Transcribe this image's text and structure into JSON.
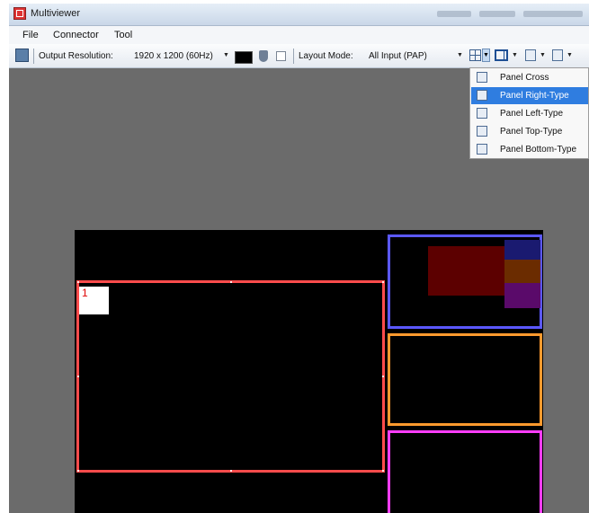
{
  "window": {
    "title": "Multiviewer"
  },
  "menubar": {
    "items": [
      "File",
      "Connector",
      "Tool"
    ]
  },
  "toolbar": {
    "output_resolution_label": "Output Resolution:",
    "output_resolution_value": "1920 x 1200 (60Hz)",
    "background_color": "#000000",
    "layout_mode_label": "Layout Mode:",
    "layout_mode_value": "All Input (PAP)"
  },
  "layout_dropdown": {
    "items": [
      "Panel Cross",
      "Panel Right-Type",
      "Panel Left-Type",
      "Panel Top-Type",
      "Panel Bottom-Type"
    ],
    "selected": "Panel Right-Type"
  },
  "preview": {
    "main_panel_number": "1",
    "colors": {
      "main_border": "#ff4c4c",
      "side_top_border": "#5b58ff",
      "side_middle_border": "#ff9a2e",
      "side_bottom_border": "#ff3dff"
    }
  }
}
